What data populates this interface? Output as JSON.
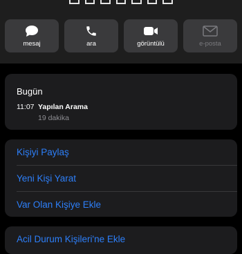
{
  "actions": [
    {
      "label": "mesaj",
      "icon": "message-icon",
      "enabled": true
    },
    {
      "label": "ara",
      "icon": "phone-icon",
      "enabled": true
    },
    {
      "label": "görüntülü",
      "icon": "video-icon",
      "enabled": true
    },
    {
      "label": "e-posta",
      "icon": "mail-icon",
      "enabled": false
    }
  ],
  "recent": {
    "heading": "Bugün",
    "time": "11:07",
    "call_type": "Yapılan Arama",
    "duration": "19 dakika"
  },
  "options": {
    "share": "Kişiyi Paylaş",
    "create": "Yeni Kişi Yarat",
    "add_existing": "Var Olan Kişiye Ekle"
  },
  "emergency": {
    "label": "Acil Durum Kişileri'ne Ekle"
  },
  "colors": {
    "accent": "#2d7ff9",
    "card": "#1c1c1e",
    "button": "#3a3a3c",
    "secondary_text": "#8e8e93"
  }
}
